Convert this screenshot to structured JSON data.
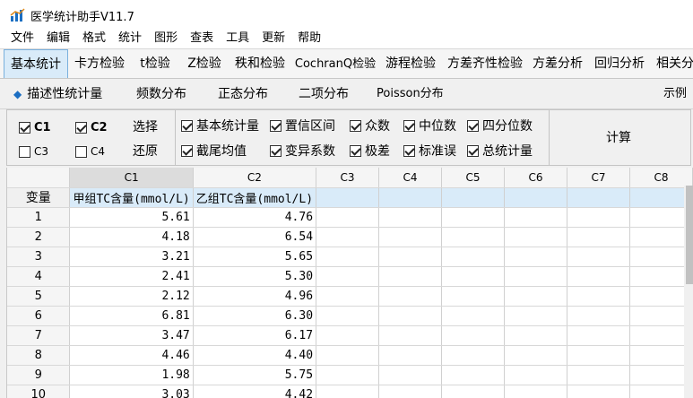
{
  "app": {
    "title": "医学统计助手V11.7"
  },
  "menu": [
    "文件",
    "编辑",
    "格式",
    "统计",
    "图形",
    "查表",
    "工具",
    "更新",
    "帮助"
  ],
  "tabs": [
    "基本统计",
    "卡方检验",
    "t检验",
    "Z检验",
    "秩和检验",
    "CochranQ检验",
    "游程检验",
    "方差齐性检验",
    "方差分析",
    "回归分析",
    "相关分"
  ],
  "active_tab": "基本统计",
  "subtabs": [
    "描述性统计量",
    "频数分布",
    "正态分布",
    "二项分布",
    "Poisson分布"
  ],
  "example_label": "示例",
  "columns_select": [
    {
      "label": "C1",
      "checked": true
    },
    {
      "label": "C2",
      "checked": true
    },
    {
      "label": "C3",
      "checked": false
    },
    {
      "label": "C4",
      "checked": false
    }
  ],
  "select_label": "选择",
  "restore_label": "还原",
  "stats_options": [
    {
      "label": "基本统计量",
      "checked": true
    },
    {
      "label": "置信区间",
      "checked": true
    },
    {
      "label": "众数",
      "checked": true
    },
    {
      "label": "中位数",
      "checked": true
    },
    {
      "label": "四分位数",
      "checked": true
    },
    {
      "label": "截尾均值",
      "checked": true
    },
    {
      "label": "变异系数",
      "checked": true
    },
    {
      "label": "极差",
      "checked": true
    },
    {
      "label": "标准误",
      "checked": true
    },
    {
      "label": "总统计量",
      "checked": true
    }
  ],
  "compute_label": "计算",
  "grid": {
    "column_headers": [
      "C1",
      "C2",
      "C3",
      "C4",
      "C5",
      "C6",
      "C7",
      "C8"
    ],
    "var_header": "变量",
    "var_labels": [
      "甲组TC含量(mmol/L)",
      "乙组TC含量(mmol/L)",
      "",
      "",
      "",
      "",
      "",
      ""
    ],
    "rows": [
      {
        "n": "1",
        "c1": "5.61",
        "c2": "4.76"
      },
      {
        "n": "2",
        "c1": "4.18",
        "c2": "6.54"
      },
      {
        "n": "3",
        "c1": "3.21",
        "c2": "5.65"
      },
      {
        "n": "4",
        "c1": "2.41",
        "c2": "5.30"
      },
      {
        "n": "5",
        "c1": "2.12",
        "c2": "4.96"
      },
      {
        "n": "6",
        "c1": "6.81",
        "c2": "6.30"
      },
      {
        "n": "7",
        "c1": "3.47",
        "c2": "6.17"
      },
      {
        "n": "8",
        "c1": "4.46",
        "c2": "4.40"
      },
      {
        "n": "9",
        "c1": "1.98",
        "c2": "5.75"
      },
      {
        "n": "10",
        "c1": "3.03",
        "c2": "4.42"
      }
    ]
  },
  "colors": {
    "active_tab_bg": "#d9ebf9",
    "accent": "#1b6ec2",
    "label_row_bg": "#d9ebf9"
  }
}
